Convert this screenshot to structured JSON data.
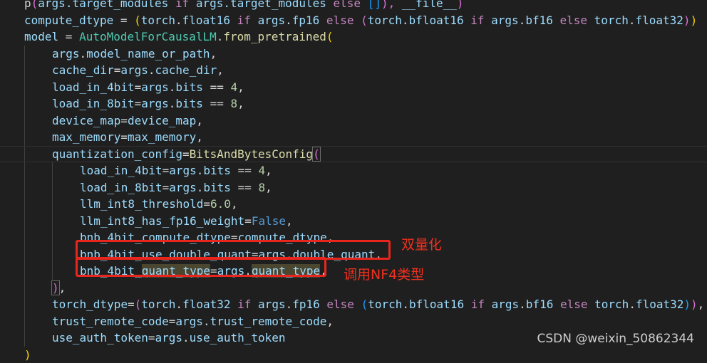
{
  "code_lines": [
    {
      "indent": 0,
      "tokens": [
        {
          "t": "p",
          "c": "p"
        },
        {
          "t": "(",
          "c": "b2"
        },
        {
          "t": "args.target_modules",
          "c": "var"
        },
        {
          "t": " ",
          "c": "p"
        },
        {
          "t": "if",
          "c": "ctrl"
        },
        {
          "t": " args.target_modules ",
          "c": "var"
        },
        {
          "t": "else",
          "c": "ctrl"
        },
        {
          "t": " ",
          "c": "p"
        },
        {
          "t": "[]",
          "c": "b3"
        },
        {
          "t": "), ",
          "c": "b2"
        },
        {
          "t": "__file__",
          "c": "var"
        },
        {
          "t": ")",
          "c": "b2"
        }
      ]
    },
    {
      "indent": 0,
      "tokens": [
        {
          "t": "compute_dtype",
          "c": "var"
        },
        {
          "t": " = ",
          "c": "p"
        },
        {
          "t": "(",
          "c": "b1"
        },
        {
          "t": "torch",
          "c": "var"
        },
        {
          "t": ".",
          "c": "p"
        },
        {
          "t": "float16",
          "c": "var"
        },
        {
          "t": " ",
          "c": "p"
        },
        {
          "t": "if",
          "c": "ctrl"
        },
        {
          "t": " ",
          "c": "p"
        },
        {
          "t": "args",
          "c": "var"
        },
        {
          "t": ".",
          "c": "p"
        },
        {
          "t": "fp16",
          "c": "var"
        },
        {
          "t": " ",
          "c": "p"
        },
        {
          "t": "else",
          "c": "ctrl"
        },
        {
          "t": " ",
          "c": "p"
        },
        {
          "t": "(",
          "c": "b2"
        },
        {
          "t": "torch",
          "c": "var"
        },
        {
          "t": ".",
          "c": "p"
        },
        {
          "t": "bfloat16",
          "c": "var"
        },
        {
          "t": " ",
          "c": "p"
        },
        {
          "t": "if",
          "c": "ctrl"
        },
        {
          "t": " ",
          "c": "p"
        },
        {
          "t": "args",
          "c": "var"
        },
        {
          "t": ".",
          "c": "p"
        },
        {
          "t": "bf16",
          "c": "var"
        },
        {
          "t": " ",
          "c": "p"
        },
        {
          "t": "else",
          "c": "ctrl"
        },
        {
          "t": " ",
          "c": "p"
        },
        {
          "t": "torch",
          "c": "var"
        },
        {
          "t": ".",
          "c": "p"
        },
        {
          "t": "float32",
          "c": "var"
        },
        {
          "t": ")",
          "c": "b2"
        },
        {
          "t": ")",
          "c": "b1"
        }
      ]
    },
    {
      "indent": 0,
      "tokens": [
        {
          "t": "model",
          "c": "var"
        },
        {
          "t": " = ",
          "c": "p"
        },
        {
          "t": "AutoModelForCausalLM",
          "c": "cls"
        },
        {
          "t": ".",
          "c": "p"
        },
        {
          "t": "from_pretrained",
          "c": "fn"
        },
        {
          "t": "(",
          "c": "b1"
        }
      ]
    },
    {
      "indent": 1,
      "tokens": [
        {
          "t": "args",
          "c": "var"
        },
        {
          "t": ".",
          "c": "p"
        },
        {
          "t": "model_name_or_path",
          "c": "var"
        },
        {
          "t": ",",
          "c": "p"
        }
      ]
    },
    {
      "indent": 1,
      "tokens": [
        {
          "t": "cache_dir",
          "c": "var"
        },
        {
          "t": "=",
          "c": "p"
        },
        {
          "t": "args",
          "c": "var"
        },
        {
          "t": ".",
          "c": "p"
        },
        {
          "t": "cache_dir",
          "c": "var"
        },
        {
          "t": ",",
          "c": "p"
        }
      ]
    },
    {
      "indent": 1,
      "tokens": [
        {
          "t": "load_in_4bit",
          "c": "var"
        },
        {
          "t": "=",
          "c": "p"
        },
        {
          "t": "args",
          "c": "var"
        },
        {
          "t": ".",
          "c": "p"
        },
        {
          "t": "bits",
          "c": "var"
        },
        {
          "t": " == ",
          "c": "p"
        },
        {
          "t": "4",
          "c": "num"
        },
        {
          "t": ",",
          "c": "p"
        }
      ]
    },
    {
      "indent": 1,
      "tokens": [
        {
          "t": "load_in_8bit",
          "c": "var"
        },
        {
          "t": "=",
          "c": "p"
        },
        {
          "t": "args",
          "c": "var"
        },
        {
          "t": ".",
          "c": "p"
        },
        {
          "t": "bits",
          "c": "var"
        },
        {
          "t": " == ",
          "c": "p"
        },
        {
          "t": "8",
          "c": "num"
        },
        {
          "t": ",",
          "c": "p"
        }
      ]
    },
    {
      "indent": 1,
      "tokens": [
        {
          "t": "device_map",
          "c": "var"
        },
        {
          "t": "=",
          "c": "p"
        },
        {
          "t": "device_map",
          "c": "var"
        },
        {
          "t": ",",
          "c": "p"
        }
      ]
    },
    {
      "indent": 1,
      "tokens": [
        {
          "t": "max_memory",
          "c": "var"
        },
        {
          "t": "=",
          "c": "p"
        },
        {
          "t": "max_memory",
          "c": "var"
        },
        {
          "t": ",",
          "c": "p"
        }
      ]
    },
    {
      "indent": 1,
      "current": true,
      "tokens": [
        {
          "t": "quantization_config",
          "c": "var"
        },
        {
          "t": "=",
          "c": "p"
        },
        {
          "t": "BitsAndBytesConfig",
          "c": "fn"
        },
        {
          "t": "(",
          "c": "b2 bm"
        }
      ]
    },
    {
      "indent": 2,
      "tokens": [
        {
          "t": "load_in_4bit",
          "c": "var"
        },
        {
          "t": "=",
          "c": "p"
        },
        {
          "t": "args",
          "c": "var"
        },
        {
          "t": ".",
          "c": "p"
        },
        {
          "t": "bits",
          "c": "var"
        },
        {
          "t": " == ",
          "c": "p"
        },
        {
          "t": "4",
          "c": "num"
        },
        {
          "t": ",",
          "c": "p"
        }
      ]
    },
    {
      "indent": 2,
      "tokens": [
        {
          "t": "load_in_8bit",
          "c": "var"
        },
        {
          "t": "=",
          "c": "p"
        },
        {
          "t": "args",
          "c": "var"
        },
        {
          "t": ".",
          "c": "p"
        },
        {
          "t": "bits",
          "c": "var"
        },
        {
          "t": " == ",
          "c": "p"
        },
        {
          "t": "8",
          "c": "num"
        },
        {
          "t": ",",
          "c": "p"
        }
      ]
    },
    {
      "indent": 2,
      "tokens": [
        {
          "t": "llm_int8_threshold",
          "c": "var"
        },
        {
          "t": "=",
          "c": "p"
        },
        {
          "t": "6.0",
          "c": "num"
        },
        {
          "t": ",",
          "c": "p"
        }
      ]
    },
    {
      "indent": 2,
      "tokens": [
        {
          "t": "llm_int8_has_fp16_weight",
          "c": "var"
        },
        {
          "t": "=",
          "c": "p"
        },
        {
          "t": "False",
          "c": "kw"
        },
        {
          "t": ",",
          "c": "p"
        }
      ]
    },
    {
      "indent": 2,
      "tokens": [
        {
          "t": "bnb_4bit_compute_dtype",
          "c": "var"
        },
        {
          "t": "=",
          "c": "p"
        },
        {
          "t": "compute_dtype",
          "c": "var"
        },
        {
          "t": ",",
          "c": "p"
        }
      ]
    },
    {
      "indent": 2,
      "tokens": [
        {
          "t": "bnb_4bit_use_double_quant",
          "c": "var"
        },
        {
          "t": "=",
          "c": "p"
        },
        {
          "t": "args",
          "c": "var"
        },
        {
          "t": ".",
          "c": "p"
        },
        {
          "t": "double_quant",
          "c": "var"
        },
        {
          "t": ",",
          "c": "p"
        }
      ]
    },
    {
      "indent": 2,
      "tokens": [
        {
          "t": "bnb_4bit_",
          "c": "var"
        },
        {
          "t": "quant_type",
          "c": "var hl"
        },
        {
          "t": "=",
          "c": "p"
        },
        {
          "t": "args",
          "c": "var"
        },
        {
          "t": ".",
          "c": "p"
        },
        {
          "t": "quant_type",
          "c": "var hl"
        },
        {
          "t": ",",
          "c": "p"
        }
      ]
    },
    {
      "indent": 1,
      "tokens": [
        {
          "t": ")",
          "c": "b2 bm"
        },
        {
          "t": ",",
          "c": "p"
        }
      ]
    },
    {
      "indent": 1,
      "tokens": [
        {
          "t": "torch_dtype",
          "c": "var"
        },
        {
          "t": "=",
          "c": "p"
        },
        {
          "t": "(",
          "c": "b2"
        },
        {
          "t": "torch",
          "c": "var"
        },
        {
          "t": ".",
          "c": "p"
        },
        {
          "t": "float32",
          "c": "var"
        },
        {
          "t": " ",
          "c": "p"
        },
        {
          "t": "if",
          "c": "ctrl"
        },
        {
          "t": " ",
          "c": "p"
        },
        {
          "t": "args",
          "c": "var"
        },
        {
          "t": ".",
          "c": "p"
        },
        {
          "t": "fp16",
          "c": "var"
        },
        {
          "t": " ",
          "c": "p"
        },
        {
          "t": "else",
          "c": "ctrl"
        },
        {
          "t": " ",
          "c": "p"
        },
        {
          "t": "(",
          "c": "b3"
        },
        {
          "t": "torch",
          "c": "var"
        },
        {
          "t": ".",
          "c": "p"
        },
        {
          "t": "bfloat16",
          "c": "var"
        },
        {
          "t": " ",
          "c": "p"
        },
        {
          "t": "if",
          "c": "ctrl"
        },
        {
          "t": " ",
          "c": "p"
        },
        {
          "t": "args",
          "c": "var"
        },
        {
          "t": ".",
          "c": "p"
        },
        {
          "t": "bf16",
          "c": "var"
        },
        {
          "t": " ",
          "c": "p"
        },
        {
          "t": "else",
          "c": "ctrl"
        },
        {
          "t": " ",
          "c": "p"
        },
        {
          "t": "torch",
          "c": "var"
        },
        {
          "t": ".",
          "c": "p"
        },
        {
          "t": "float32",
          "c": "var"
        },
        {
          "t": ")",
          "c": "b3"
        },
        {
          "t": ")",
          "c": "b2"
        },
        {
          "t": ",",
          "c": "p"
        }
      ]
    },
    {
      "indent": 1,
      "tokens": [
        {
          "t": "trust_remote_code",
          "c": "var"
        },
        {
          "t": "=",
          "c": "p"
        },
        {
          "t": "args",
          "c": "var"
        },
        {
          "t": ".",
          "c": "p"
        },
        {
          "t": "trust_remote_code",
          "c": "var"
        },
        {
          "t": ",",
          "c": "p"
        }
      ]
    },
    {
      "indent": 1,
      "tokens": [
        {
          "t": "use_auth_token",
          "c": "var"
        },
        {
          "t": "=",
          "c": "p"
        },
        {
          "t": "args",
          "c": "var"
        },
        {
          "t": ".",
          "c": "p"
        },
        {
          "t": "use_auth_token",
          "c": "var"
        }
      ]
    },
    {
      "indent": 0,
      "tokens": [
        {
          "t": ")",
          "c": "b1"
        }
      ]
    }
  ],
  "annotations": {
    "double_quant_label": "双量化",
    "quant_type_label": "调用NF4类型"
  },
  "colors": {
    "background": "#1f1f1f",
    "annotation_red": "#e8261e"
  },
  "watermark": "CSDN @weixin_50862344"
}
